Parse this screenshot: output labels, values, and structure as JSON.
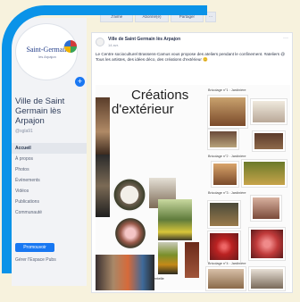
{
  "sidebar": {
    "logo_text": "Saint-Germain",
    "logo_subtext": "les Arpajon",
    "page_name": "Ville de Saint Germain lès Arpajon",
    "handle": "@sgla91",
    "nav": [
      "Accueil",
      "À propos",
      "Photos",
      "Évènements",
      "Vidéos",
      "Publications",
      "Communauté"
    ],
    "promote_label": "Promouvoir",
    "manage_label": "Gérer l'Espace Pubs"
  },
  "topbar": {
    "tabs": [
      "J'aime",
      "Abonné(e)",
      "Partager",
      "···"
    ]
  },
  "post": {
    "author": "Ville de Saint Germain lès Arpajon",
    "time": "14 avr.",
    "menu": "···",
    "text": "Le Centre socioculturel Brassens-Camus vous propose des ateliers pendant le confinement. #ateliers @ Tous les artistes, des idées déco, des créations d'extérieur 😊"
  },
  "collage": {
    "title_line1": "Créations",
    "title_line2": "d'extérieur",
    "caption": "Dentelle",
    "sections": [
      "Bricolage n°1 : Jardinière",
      "Bricolage n°2 : Jardinière",
      "Bricolage n°3 : Jardinière",
      "Bricolage n°4 : Jardinière"
    ]
  },
  "colors": {
    "accent_arc": "#0a93e8",
    "button_blue": "#1877f2",
    "sidebar_bg": "#f2f3f6"
  }
}
